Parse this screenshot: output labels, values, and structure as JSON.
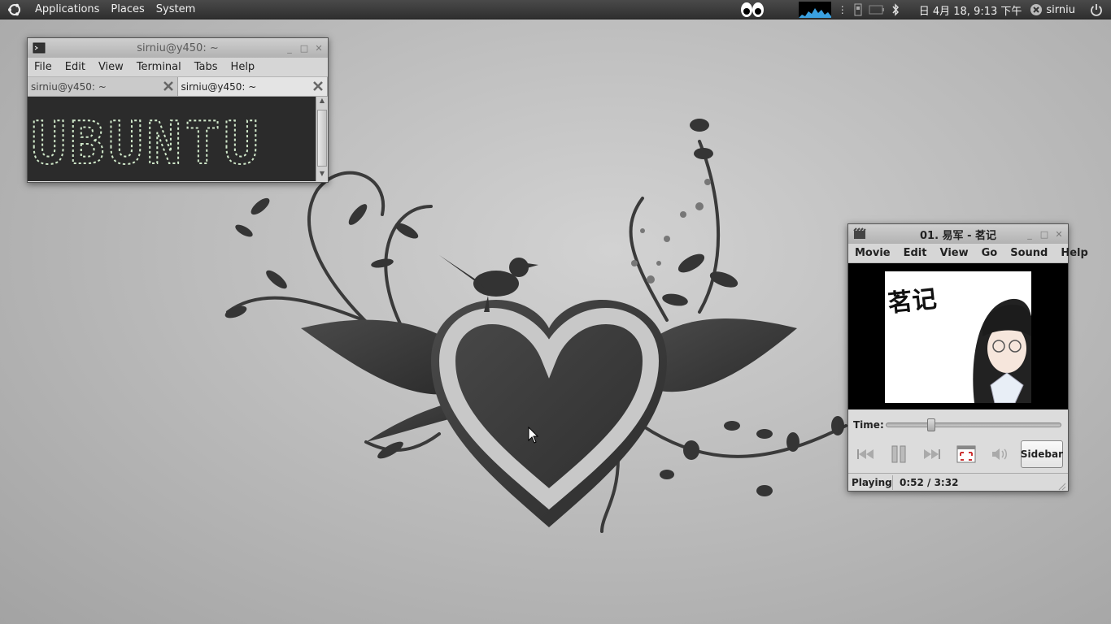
{
  "panel": {
    "menus": [
      "Applications",
      "Places",
      "System"
    ],
    "clock": "日 4月 18, 9:13 下午",
    "user": "sirniu"
  },
  "terminal": {
    "title": "sirniu@y450: ~",
    "menu": [
      "File",
      "Edit",
      "View",
      "Terminal",
      "Tabs",
      "Help"
    ],
    "tabs": [
      "sirniu@y450: ~",
      "sirniu@y450: ~"
    ],
    "banner": "UBUNTU"
  },
  "player": {
    "title": "01. 易军 - 茗记",
    "menu": [
      "Movie",
      "Edit",
      "View",
      "Go",
      "Sound",
      "Help"
    ],
    "time_label": "Time:",
    "progress": 0.246,
    "sidebar_label": "Sidebar",
    "status": "Playing",
    "position": "0:52 / 3:32",
    "art_text": "茗记"
  }
}
